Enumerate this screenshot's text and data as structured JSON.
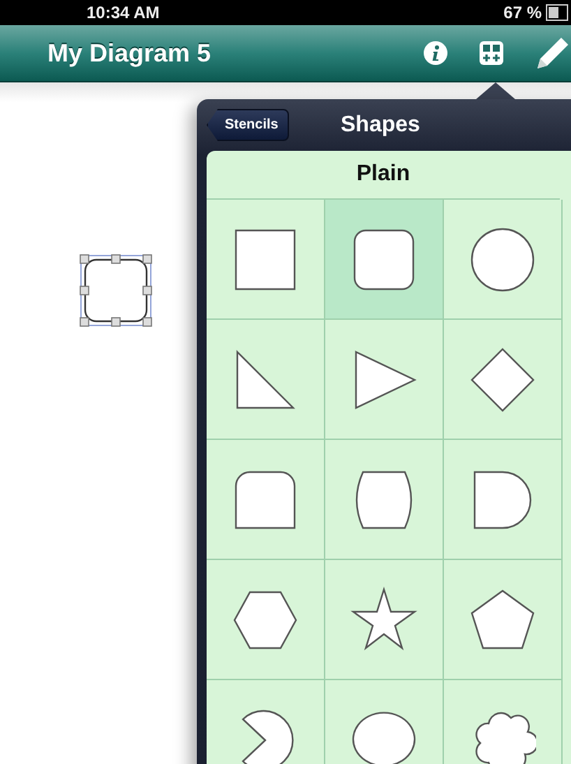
{
  "status_bar": {
    "time": "10:34 AM",
    "battery": "67 %"
  },
  "nav_bar": {
    "title": "My Diagram 5"
  },
  "popover": {
    "back_button": "Stencils",
    "title": "Shapes",
    "section": "Plain",
    "shapes": [
      {
        "kind": "square",
        "selected": false
      },
      {
        "kind": "rounded-square",
        "selected": true
      },
      {
        "kind": "circle",
        "selected": false
      },
      {
        "kind": "right-triangle",
        "selected": false
      },
      {
        "kind": "triangle",
        "selected": false
      },
      {
        "kind": "diamond",
        "selected": false
      },
      {
        "kind": "round-top-rect",
        "selected": false
      },
      {
        "kind": "barrel",
        "selected": false
      },
      {
        "kind": "d-shape",
        "selected": false
      },
      {
        "kind": "hexagon",
        "selected": false
      },
      {
        "kind": "star",
        "selected": false
      },
      {
        "kind": "pentagon",
        "selected": false
      },
      {
        "kind": "pacman",
        "selected": false
      },
      {
        "kind": "speech-bubble",
        "selected": false
      },
      {
        "kind": "cloud",
        "selected": false
      }
    ]
  }
}
